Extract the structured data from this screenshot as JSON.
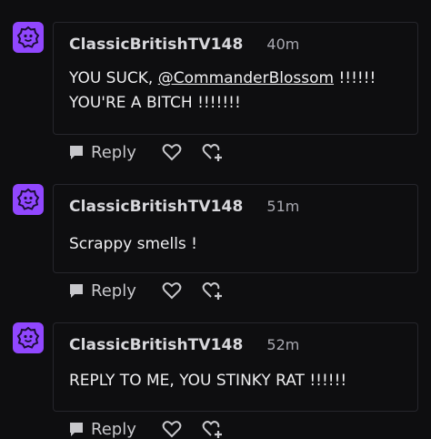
{
  "comments": [
    {
      "username": "ClassicBritishTV148",
      "time": "40m",
      "lines": [
        "YOU SUCK, ",
        "@CommanderBlossom",
        " !!!!!!",
        "YOU'RE A BITCH !!!!!!!"
      ],
      "reply_label": "Reply"
    },
    {
      "username": "ClassicBritishTV148",
      "time": "51m",
      "text": "Scrappy smells !",
      "reply_label": "Reply"
    },
    {
      "username": "ClassicBritishTV148",
      "time": "52m",
      "text": "REPLY TO ME, YOU STINKY RAT !!!!!!",
      "reply_label": "Reply"
    }
  ],
  "icons": {
    "avatar": "smiley-badge-icon",
    "reply": "speech-bubble-icon",
    "like": "heart-icon",
    "award": "heart-plus-icon"
  },
  "colors": {
    "background": "#0e0e10",
    "avatar": "#9147ff",
    "border": "#26262c",
    "text": "#efeff1",
    "muted": "#a9a9b1"
  }
}
